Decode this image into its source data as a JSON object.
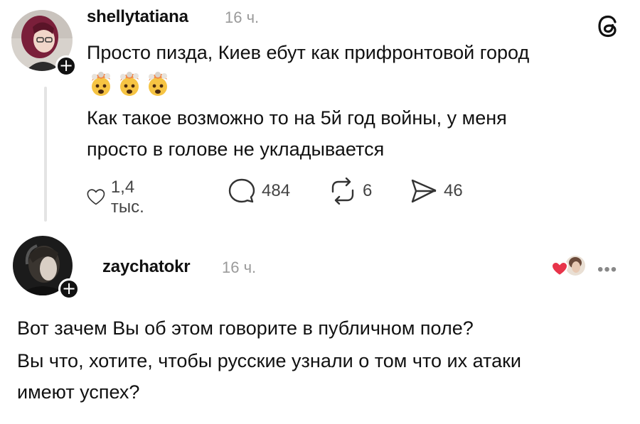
{
  "post1": {
    "username": "shellytatiana",
    "time": "16 ч.",
    "line1": "Просто пизда, Киев ебут как прифронтовой город",
    "emoji_icons": [
      "exploding-head-icon",
      "exploding-head-icon",
      "exploding-head-icon"
    ],
    "line2": "Как такое возможно то на 5й год войны, у меня",
    "line3": "просто в голове не укладывается",
    "actions": {
      "likes": "1,4 тыс.",
      "comments": "484",
      "reposts": "6",
      "shares": "46"
    }
  },
  "post2": {
    "username": "zaychatokr",
    "time": "16 ч.",
    "line1": "Вот зачем Вы об этом говорите в публичном поле?",
    "line2": "Вы что, хотите, чтобы русские узнали о том что их атаки",
    "line3": "имеют успех?",
    "more_label": "•••"
  },
  "colors": {
    "text": "#111111",
    "muted": "#9a9a9a",
    "line": "#e4e4e4"
  }
}
